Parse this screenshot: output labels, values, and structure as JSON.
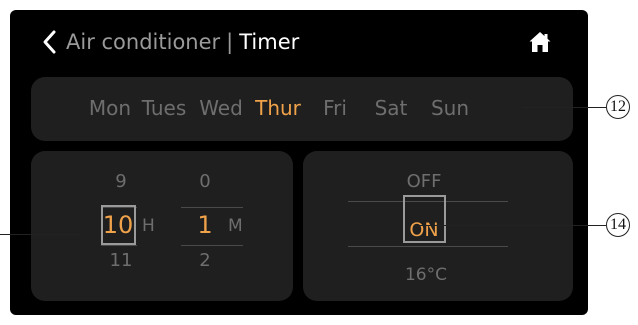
{
  "header": {
    "breadcrumb": "Air conditioner",
    "separator": "|",
    "current": "Timer",
    "back_icon": "chevron-left-icon",
    "home_icon": "home-icon"
  },
  "days": [
    {
      "label": "Mon",
      "active": false
    },
    {
      "label": "Tues",
      "active": false
    },
    {
      "label": "Wed",
      "active": false
    },
    {
      "label": "Thur",
      "active": true
    },
    {
      "label": "Fri",
      "active": false
    },
    {
      "label": "Sat",
      "active": false
    },
    {
      "label": "Sun",
      "active": false
    }
  ],
  "time_picker": {
    "hour_prev": "9",
    "hour_selected": "10",
    "hour_next": "11",
    "hour_unit": "H",
    "minute_prev": "0",
    "minute_selected": "1",
    "minute_next": "2",
    "minute_unit": "M"
  },
  "mode_picker": {
    "prev": "OFF",
    "selected": "ON",
    "next": "16°C"
  },
  "callouts": {
    "days": "12",
    "mode": "14"
  },
  "colors": {
    "accent": "#f0a24a",
    "background": "#000000",
    "panel": "#1f1f1f",
    "muted_text": "#6e6e6e"
  }
}
